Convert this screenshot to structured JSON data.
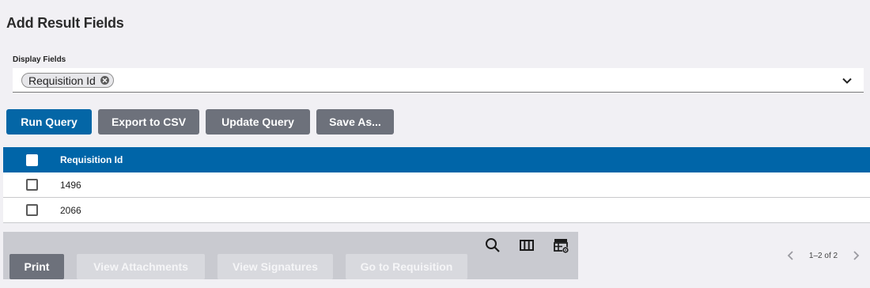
{
  "header": {
    "title": "Add Result Fields"
  },
  "display_fields": {
    "label": "Display Fields",
    "selected_chip": "Requisition Id",
    "chip_remove_icon": "close-circle-icon",
    "dropdown_icon": "chevron-down-icon"
  },
  "actions": {
    "run_query": "Run Query",
    "export_csv": "Export to CSV",
    "update_query": "Update Query",
    "save_as": "Save As..."
  },
  "table": {
    "column_header": "Requisition Id",
    "rows": [
      {
        "requisition_id": "1496"
      },
      {
        "requisition_id": "2066"
      }
    ]
  },
  "toolbar": {
    "icons": [
      "search-icon",
      "columns-icon",
      "table-settings-icon"
    ],
    "print": "Print",
    "view_attachments": "View Attachments",
    "view_signatures": "View Signatures",
    "go_to_requisition": "Go to Requisition"
  },
  "pagination": {
    "range_text": "1–2 of 2"
  },
  "colors": {
    "primary": "#0466a6",
    "header_bg": "#0065a8",
    "secondary_button": "#6d717b",
    "disabled_button": "#d8d9de",
    "page_bg": "#f1f0f4"
  }
}
